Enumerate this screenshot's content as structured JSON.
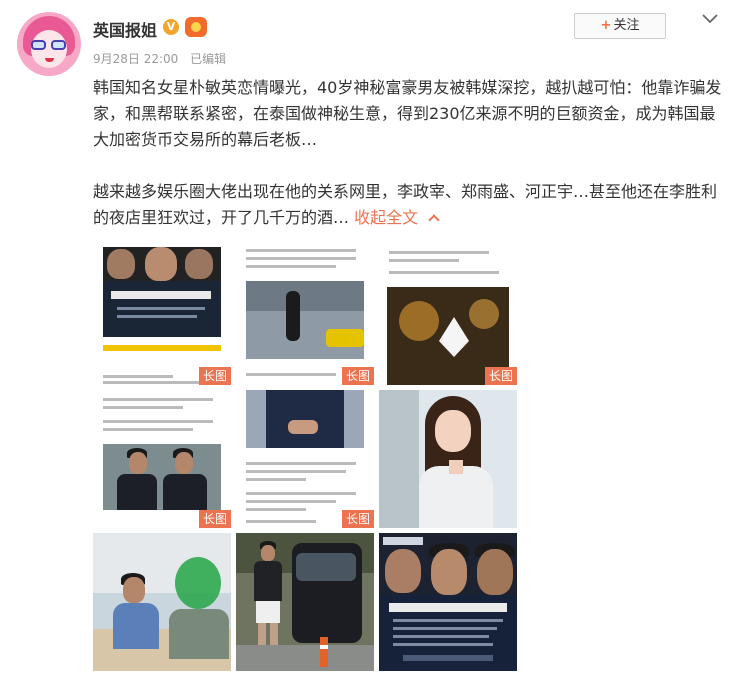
{
  "user": {
    "name": "英国报姐",
    "verified_badge": "V",
    "avatar_icon": "cartoon-girl-avatar"
  },
  "meta": {
    "time": "9月28日 22:00",
    "edited": "已编辑"
  },
  "follow": {
    "plus": "+",
    "label": "关注"
  },
  "post": {
    "paragraph1": "韩国知名女星朴敏英恋情曝光，40岁神秘富豪男友被韩媒深挖，越扒越可怕：他靠诈骗发家，和黑帮联系紧密，在泰国做神秘生意，得到230亿来源不明的巨额资金，成为韩国最大加密货币交易所的幕后老板…",
    "paragraph2": "越来越多娱乐圈大佬出现在他的关系网里，李政宰、郑雨盛、河正宇…甚至他还在李胜利的夜店里狂欢过，开了几千万的酒…",
    "collapse_label": "收起全文"
  },
  "images": {
    "long_badge": "长图",
    "tiles": [
      {
        "kind": "long",
        "desc": "poster"
      },
      {
        "kind": "long",
        "desc": "street"
      },
      {
        "kind": "long",
        "desc": "club"
      },
      {
        "kind": "long",
        "desc": "meeting"
      },
      {
        "kind": "long",
        "desc": "suit"
      },
      {
        "kind": "normal",
        "desc": "actress"
      },
      {
        "kind": "normal",
        "desc": "boat"
      },
      {
        "kind": "normal",
        "desc": "van"
      },
      {
        "kind": "normal",
        "desc": "poster2"
      }
    ]
  },
  "colors": {
    "accent": "#eb7350",
    "text": "#333333",
    "muted": "#999999"
  }
}
